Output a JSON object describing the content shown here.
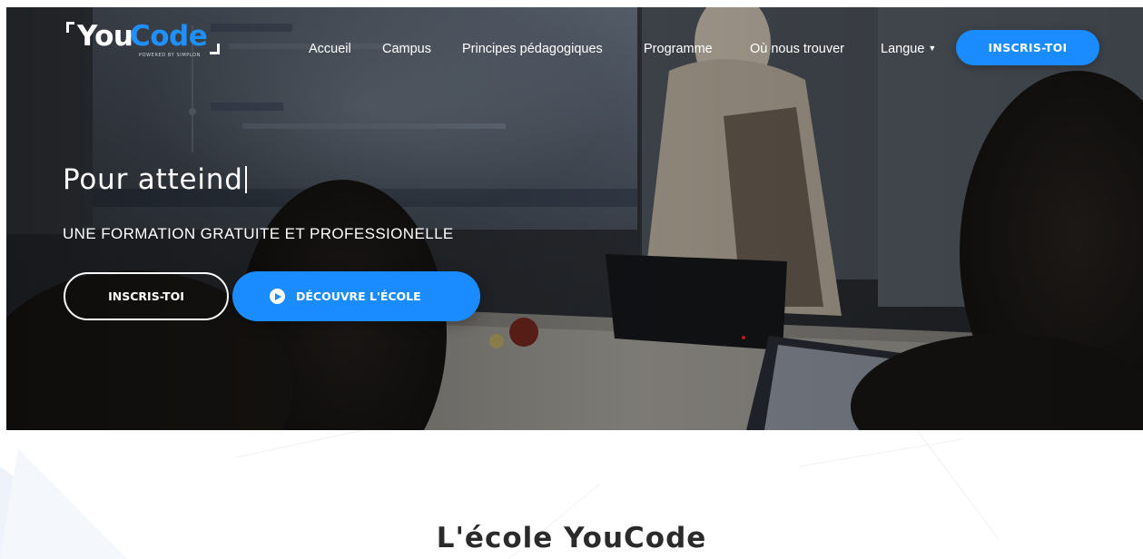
{
  "brand": {
    "name_part1": "You",
    "name_part2": "Code",
    "tagline": "POWERED BY SIMPLON",
    "accent": "#1a8cff"
  },
  "nav": {
    "items": [
      {
        "label": "Accueil"
      },
      {
        "label": "Campus"
      },
      {
        "label": "Principes pédagogiques"
      },
      {
        "label": "Programme"
      },
      {
        "label": "Où nous trouver"
      },
      {
        "label": "Langue",
        "icon": "caret-down-icon"
      }
    ],
    "cta_label": "INSCRIS-TOI"
  },
  "hero": {
    "title": "Pour atteind",
    "subtitle": "UNE FORMATION GRATUITE ET PROFESSIONELLE",
    "btn_outline_label": "INSCRIS-TOI",
    "btn_primary_label": "DÉCOUVRE L'ÉCOLE",
    "btn_primary_icon": "play-circle-icon"
  },
  "section": {
    "title": "L'école YouCode"
  }
}
